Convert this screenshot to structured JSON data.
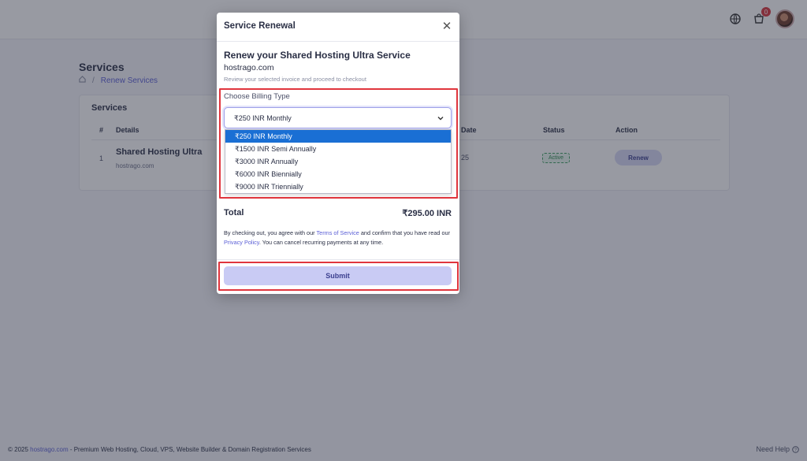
{
  "header": {
    "cart_count": "0"
  },
  "page": {
    "title": "Services",
    "breadcrumb": "Renew Services"
  },
  "services_card": {
    "title": "Services",
    "columns": {
      "index": "#",
      "details": "Details",
      "date": "Date",
      "status": "Status",
      "action": "Action"
    },
    "row": {
      "index": "1",
      "name": "Shared Hosting Ultra",
      "domain": "hostrago.com",
      "date_fragment": "25",
      "status": "Active",
      "action": "Renew"
    }
  },
  "modal": {
    "title": "Service Renewal",
    "heading": "Renew your Shared Hosting Ultra Service",
    "domain": "hostrago.com",
    "subtitle": "Review your selected invoice and proceed to checkout",
    "billing_label": "Choose Billing Type",
    "selected_option": "₹250 INR Monthly",
    "options": [
      "₹250 INR Monthly",
      "₹1500 INR Semi Annually",
      "₹3000 INR Annually",
      "₹6000 INR Biennially",
      "₹9000 INR Triennially"
    ],
    "total_label": "Total",
    "total_value": "₹295.00 INR",
    "terms": {
      "part1": "By checking out, you agree with our ",
      "tos_link": "Terms of Service",
      "part2": " and confirm that you have read our ",
      "privacy_link": "Privacy Policy",
      "part3": ". You can cancel recurring payments at any time."
    },
    "submit_label": "Submit"
  },
  "footer": {
    "prefix": "© 2025 ",
    "brand": "hostrago.com",
    "suffix": " - Premium Web Hosting, Cloud, VPS, Website Builder & Domain Registration Services",
    "help": "Need Help"
  },
  "colors": {
    "accent": "#5b5fd6",
    "highlight": "#e0353d",
    "selected_option": "#1a6fd4"
  }
}
